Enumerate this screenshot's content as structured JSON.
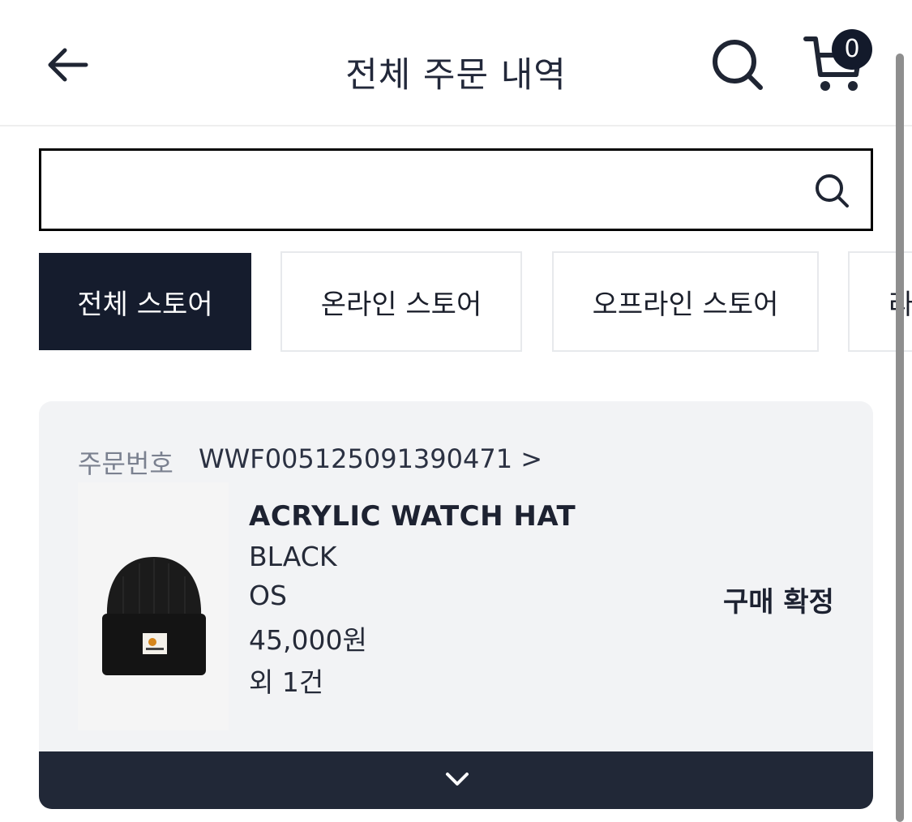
{
  "header": {
    "title": "전체 주문 내역",
    "back_icon": "arrow-left-icon",
    "search_icon": "search-icon",
    "cart_icon": "cart-icon",
    "cart_count": "0"
  },
  "search": {
    "value": "",
    "placeholder": "",
    "icon": "search-icon"
  },
  "tabs": [
    {
      "label": "전체 스토어",
      "active": true
    },
    {
      "label": "온라인 스토어",
      "active": false
    },
    {
      "label": "오프라인 스토어",
      "active": false
    },
    {
      "label": "라",
      "active": false
    }
  ],
  "order": {
    "number_label": "주문번호",
    "number": "WWF005125091390471 >",
    "product": {
      "name": "ACRYLIC WATCH HAT",
      "color": "BLACK",
      "size": "OS",
      "price": "45,000원",
      "extra": "외 1건",
      "image": "beanie-image"
    },
    "status": "구매 확정",
    "expand_icon": "chevron-down-icon"
  },
  "colors": {
    "primary": "#151c2d",
    "card_bg": "#f2f3f5",
    "expand_bar": "#212837",
    "muted_text": "#7b8190"
  }
}
